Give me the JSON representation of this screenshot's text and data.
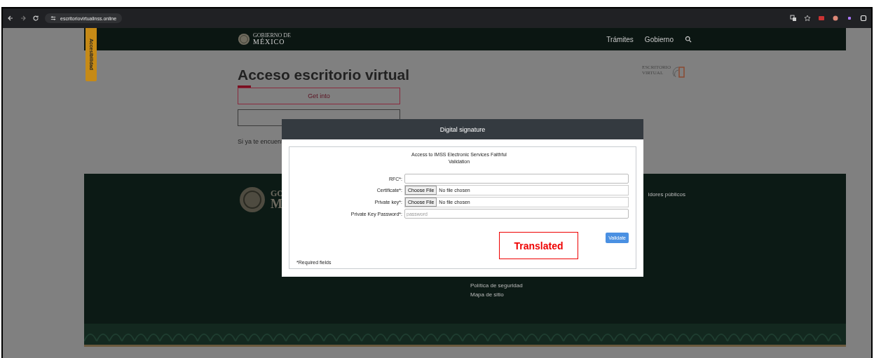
{
  "browser": {
    "url": "escritoriovirtualinss.online"
  },
  "accessibility_tab": {
    "label": "Accesibilidad"
  },
  "header": {
    "logo_small": "GOBIERNO DE",
    "logo_large": "MÉXICO",
    "nav": [
      {
        "label": "Trámites"
      },
      {
        "label": "Gobierno"
      }
    ]
  },
  "main": {
    "title": "Acceso escritorio virtual",
    "login_button": "Get into",
    "text_fragment": "Si ya te encuent",
    "brand": {
      "line1": "ESCRITORIO",
      "line2": "VIRTUAL"
    }
  },
  "footer": {
    "logo_fragments": [
      "GO",
      "M"
    ],
    "text_fragment": "idores públicos",
    "links": [
      "Política de seguridad",
      "Mapa de sitio"
    ]
  },
  "modal": {
    "title": "Digital signature",
    "intro": "Access to IMSS Electronic Services Faithful Validation",
    "fields": [
      {
        "label": "RFC*:",
        "kind": "text"
      },
      {
        "label": "Certificate*:",
        "kind": "file",
        "button": "Choose File",
        "value": "No file chosen"
      },
      {
        "label": "Private key*:",
        "kind": "file",
        "button": "Choose File",
        "value": "No file chosen"
      },
      {
        "label": "Private Key Password*:",
        "kind": "password",
        "placeholder": "password"
      }
    ],
    "submit": "Validate",
    "note": "*Required fields"
  },
  "annotation": {
    "label": "Translated"
  }
}
